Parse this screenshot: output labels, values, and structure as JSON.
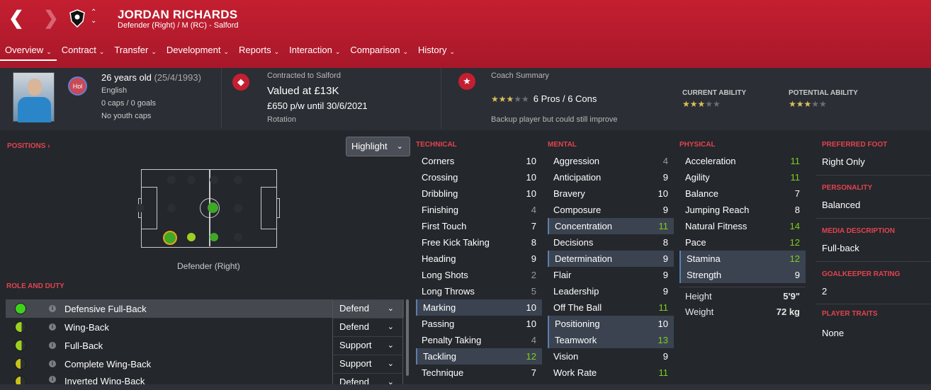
{
  "header": {
    "name": "JORDAN RICHARDS",
    "subtitle": "Defender (Right) / M (RC) - Salford",
    "back_icon": "chevron-left-icon",
    "forward_icon": "chevron-right-icon"
  },
  "tabs": [
    {
      "label": "Overview"
    },
    {
      "label": "Contract"
    },
    {
      "label": "Transfer"
    },
    {
      "label": "Development"
    },
    {
      "label": "Reports"
    },
    {
      "label": "Interaction"
    },
    {
      "label": "Comparison"
    },
    {
      "label": "History"
    }
  ],
  "bio": {
    "age": "26 years old",
    "dob": "(25/4/1993)",
    "nationality": "English",
    "flag_text": "Hol",
    "caps": "0 caps / 0 goals",
    "youth_caps": "No youth caps"
  },
  "contract": {
    "label": "Contracted to Salford",
    "value": "Valued at £13K",
    "wage": "£650 p/w until 30/6/2021",
    "status": "Rotation"
  },
  "coach": {
    "label": "Coach Summary",
    "stars": 3,
    "pros_cons": "6 Pros / 6 Cons",
    "summary": "Backup player but could still improve",
    "current_ability_label": "CURRENT ABILITY",
    "current_ability_stars": 3,
    "potential_ability_label": "POTENTIAL ABILITY",
    "potential_ability_stars": 3
  },
  "positions": {
    "header": "POSITIONS",
    "highlight_label": "Highlight",
    "position_label": "Defender (Right)"
  },
  "roles": {
    "header": "ROLE AND DUTY",
    "items": [
      {
        "name": "Defensive Full-Back",
        "duty": "Defend",
        "color": "#3fd11b"
      },
      {
        "name": "Wing-Back",
        "duty": "Defend",
        "color": "#9bd01e"
      },
      {
        "name": "Full-Back",
        "duty": "Support",
        "color": "#9bd01e"
      },
      {
        "name": "Complete Wing-Back",
        "duty": "Support",
        "color": "#c9c21a"
      },
      {
        "name": "Inverted Wing-Back",
        "duty": "Defend",
        "color": "#c9c21a"
      }
    ]
  },
  "technical": {
    "header": "TECHNICAL",
    "attrs": [
      {
        "name": "Corners",
        "value": "10"
      },
      {
        "name": "Crossing",
        "value": "10"
      },
      {
        "name": "Dribbling",
        "value": "10"
      },
      {
        "name": "Finishing",
        "value": "4"
      },
      {
        "name": "First Touch",
        "value": "7"
      },
      {
        "name": "Free Kick Taking",
        "value": "8"
      },
      {
        "name": "Heading",
        "value": "9"
      },
      {
        "name": "Long Shots",
        "value": "2"
      },
      {
        "name": "Long Throws",
        "value": "5"
      },
      {
        "name": "Marking",
        "value": "10"
      },
      {
        "name": "Passing",
        "value": "10"
      },
      {
        "name": "Penalty Taking",
        "value": "4"
      },
      {
        "name": "Tackling",
        "value": "12"
      },
      {
        "name": "Technique",
        "value": "7"
      }
    ]
  },
  "mental": {
    "header": "MENTAL",
    "attrs": [
      {
        "name": "Aggression",
        "value": "4"
      },
      {
        "name": "Anticipation",
        "value": "9"
      },
      {
        "name": "Bravery",
        "value": "10"
      },
      {
        "name": "Composure",
        "value": "9"
      },
      {
        "name": "Concentration",
        "value": "11"
      },
      {
        "name": "Decisions",
        "value": "8"
      },
      {
        "name": "Determination",
        "value": "9"
      },
      {
        "name": "Flair",
        "value": "9"
      },
      {
        "name": "Leadership",
        "value": "9"
      },
      {
        "name": "Off The Ball",
        "value": "11"
      },
      {
        "name": "Positioning",
        "value": "10"
      },
      {
        "name": "Teamwork",
        "value": "13"
      },
      {
        "name": "Vision",
        "value": "9"
      },
      {
        "name": "Work Rate",
        "value": "11"
      }
    ]
  },
  "physical": {
    "header": "PHYSICAL",
    "attrs": [
      {
        "name": "Acceleration",
        "value": "11"
      },
      {
        "name": "Agility",
        "value": "11"
      },
      {
        "name": "Balance",
        "value": "7"
      },
      {
        "name": "Jumping Reach",
        "value": "8"
      },
      {
        "name": "Natural Fitness",
        "value": "14"
      },
      {
        "name": "Pace",
        "value": "12"
      },
      {
        "name": "Stamina",
        "value": "12"
      },
      {
        "name": "Strength",
        "value": "9"
      }
    ],
    "height_label": "Height",
    "height": "5'9\"",
    "weight_label": "Weight",
    "weight": "72 kg"
  },
  "side": {
    "preferred_foot_label": "PREFERRED FOOT",
    "preferred_foot": "Right Only",
    "personality_label": "PERSONALITY",
    "personality": "Balanced",
    "media_label": "MEDIA DESCRIPTION",
    "media": "Full-back",
    "gk_label": "GOALKEEPER RATING",
    "gk": "2",
    "traits_label": "PLAYER TRAITS",
    "traits": "None"
  },
  "colors": {
    "accent": "#c41f31",
    "green": "#7dcf1e",
    "header_red": "#e2434f"
  }
}
